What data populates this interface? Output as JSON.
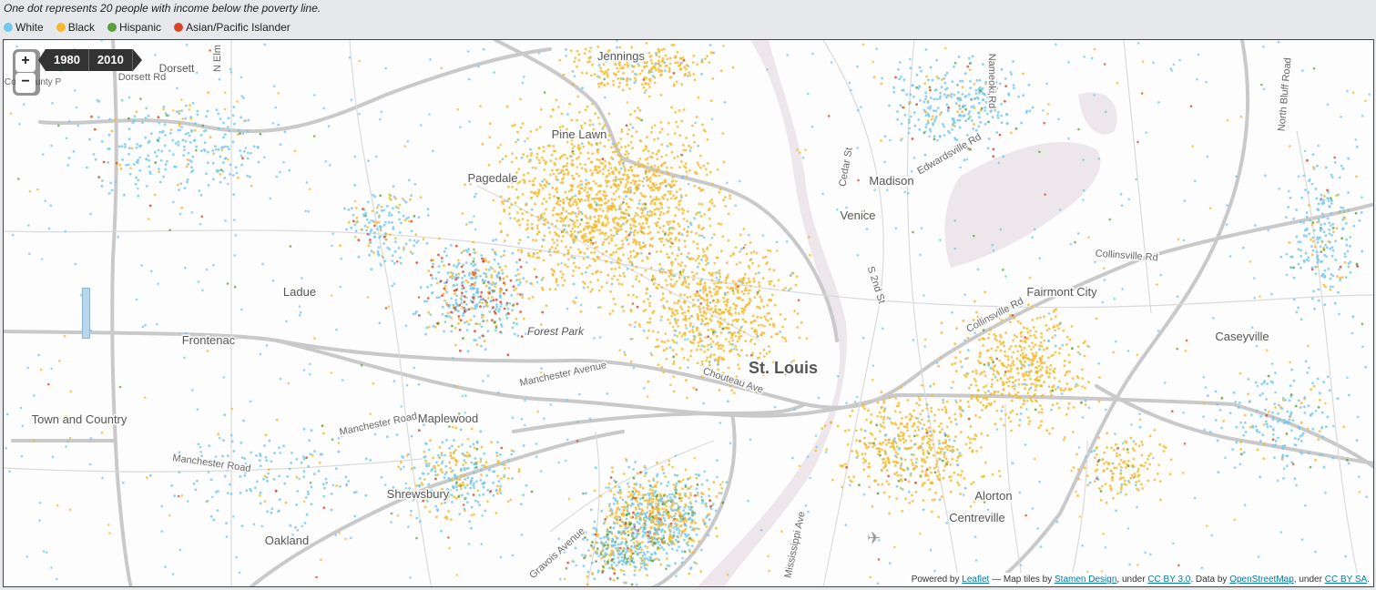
{
  "caption": "One dot represents 20 people with income below the poverty line.",
  "legend": [
    {
      "label": "White",
      "color": "#72c7ec"
    },
    {
      "label": "Black",
      "color": "#f5b92b"
    },
    {
      "label": "Hispanic",
      "color": "#5c9e3a"
    },
    {
      "label": "Asian/Pacific Islander",
      "color": "#d8432a"
    }
  ],
  "controls": {
    "zoom_in": "+",
    "zoom_out": "−",
    "years": [
      "1980",
      "2010"
    ]
  },
  "map": {
    "places": [
      {
        "name": "Jennings"
      },
      {
        "name": "Pine Lawn"
      },
      {
        "name": "Pagedale"
      },
      {
        "name": "Ladue"
      },
      {
        "name": "Frontenac"
      },
      {
        "name": "Town and Country"
      },
      {
        "name": "Maplewood"
      },
      {
        "name": "Shrewsbury"
      },
      {
        "name": "Oakland"
      },
      {
        "name": "St. Louis"
      },
      {
        "name": "Madison"
      },
      {
        "name": "Venice"
      },
      {
        "name": "Fairmont City"
      },
      {
        "name": "Caseyville"
      },
      {
        "name": "Alorton"
      },
      {
        "name": "Centreville"
      },
      {
        "name": "Dorsett"
      },
      {
        "name": "Forest Park"
      }
    ],
    "roads": [
      {
        "name": "Dorsett Rd"
      },
      {
        "name": "N Elm"
      },
      {
        "name": "Manchester Avenue"
      },
      {
        "name": "Manchester Road"
      },
      {
        "name": "Manchester Road"
      },
      {
        "name": "Chouteau Ave"
      },
      {
        "name": "Gravois Avenue"
      },
      {
        "name": "Mississippi Ave"
      },
      {
        "name": "Cedar St"
      },
      {
        "name": "S 2nd St"
      },
      {
        "name": "Collinsville Rd"
      },
      {
        "name": "Collinsville Rd"
      },
      {
        "name": "Edwardsville Rd"
      },
      {
        "name": "Nameoki Rd"
      },
      {
        "name": "North Bluff Road"
      },
      {
        "name": "Coe County P"
      }
    ]
  },
  "attribution": {
    "powered_by": "Powered by",
    "leaflet": "Leaflet",
    "map_tiles": " — Map tiles by ",
    "stamen": "Stamen Design",
    "under1": ", under ",
    "ccby": "CC BY 3.0",
    "data_by": ". Data by ",
    "osm": "OpenStreetMap",
    "under2": ", under ",
    "ccbysa": "CC BY SA",
    "end": "."
  }
}
